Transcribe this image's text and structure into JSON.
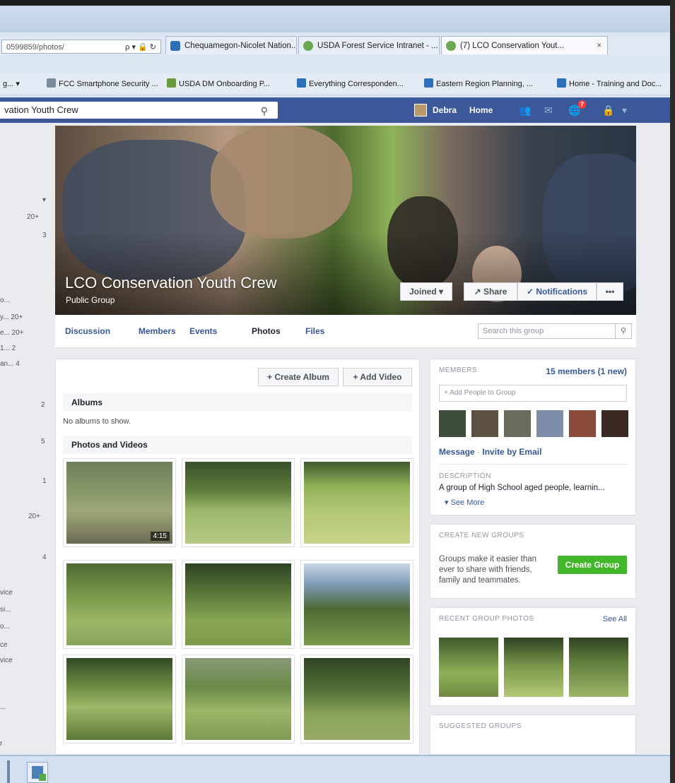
{
  "browser": {
    "url": "0599859/photos/",
    "url_tools": "ρ ▾ 🔒 ↻",
    "tabs": [
      {
        "label": "Chequamegon-Nicolet Nation...",
        "active": false
      },
      {
        "label": "USDA Forest Service Intranet - ...",
        "active": false
      },
      {
        "label": "(7) LCO Conservation Yout...",
        "active": true
      }
    ],
    "tab_close": "×",
    "favorites": [
      {
        "label": "g... ▾"
      },
      {
        "label": "FCC Smartphone Security ..."
      },
      {
        "label": "USDA DM Onboarding P..."
      },
      {
        "label": "Everything Corresponden..."
      },
      {
        "label": "Eastern Region Planning, ..."
      },
      {
        "label": "Home - Training and Doc..."
      }
    ]
  },
  "fb_header": {
    "search_value": "vation Youth Crew",
    "search_icon": "search-icon",
    "user_name": "Debra",
    "home_label": "Home",
    "notif_count": "7"
  },
  "left_col": {
    "counts": [
      {
        "text": "▾"
      },
      {
        "text": "20+"
      },
      {
        "text": "3"
      },
      {
        "text": "o..."
      },
      {
        "text": "y... 20+"
      },
      {
        "text": "e... 20+"
      },
      {
        "text": "1... 2"
      },
      {
        "text": "an... 4"
      },
      {
        "text": "2"
      },
      {
        "text": "5"
      },
      {
        "text": "1"
      },
      {
        "text": "20+"
      },
      {
        "text": "4"
      },
      {
        "text": "vice"
      },
      {
        "text": "si..."
      },
      {
        "text": "o..."
      },
      {
        "text": "ce"
      },
      {
        "text": "vice"
      },
      {
        "text": "..."
      },
      {
        "text": "r"
      }
    ]
  },
  "cover": {
    "group_name": "LCO Conservation Youth Crew",
    "group_type": "Public Group",
    "joined_label": "Joined ▾",
    "share_label": "↗ Share",
    "notifications_label": "✓ Notifications",
    "more_label": "•••"
  },
  "group_tabs": {
    "items": [
      {
        "label": "Discussion"
      },
      {
        "label": "Members"
      },
      {
        "label": "Events"
      },
      {
        "label": "Photos"
      },
      {
        "label": "Files"
      }
    ],
    "search_placeholder": "Search this group"
  },
  "photos": {
    "create_album": "+ Create Album",
    "add_video": "+ Add Video",
    "albums_heading": "Albums",
    "no_albums": "No albums to show.",
    "pv_heading": "Photos and Videos",
    "video_duration": "4:15"
  },
  "members_card": {
    "heading": "MEMBERS",
    "count": "15 members (1 new)",
    "add_placeholder": "+ Add People to Group",
    "message": "Message",
    "sep": "·",
    "invite": "Invite by Email",
    "desc_heading": "DESCRIPTION",
    "description": "A group of High School aged people, learnin...",
    "see_more": "▾  See More"
  },
  "create_card": {
    "heading": "CREATE NEW GROUPS",
    "text": "Groups make it easier than ever to share with friends, family and teammates.",
    "button": "Create Group"
  },
  "recent_card": {
    "heading": "RECENT GROUP PHOTOS",
    "see_all": "See All"
  },
  "suggested_card": {
    "heading": "SUGGESTED GROUPS"
  },
  "colors": {
    "fb_blue": "#3b5998",
    "link_blue": "#365899",
    "create_green": "#42b72a"
  }
}
